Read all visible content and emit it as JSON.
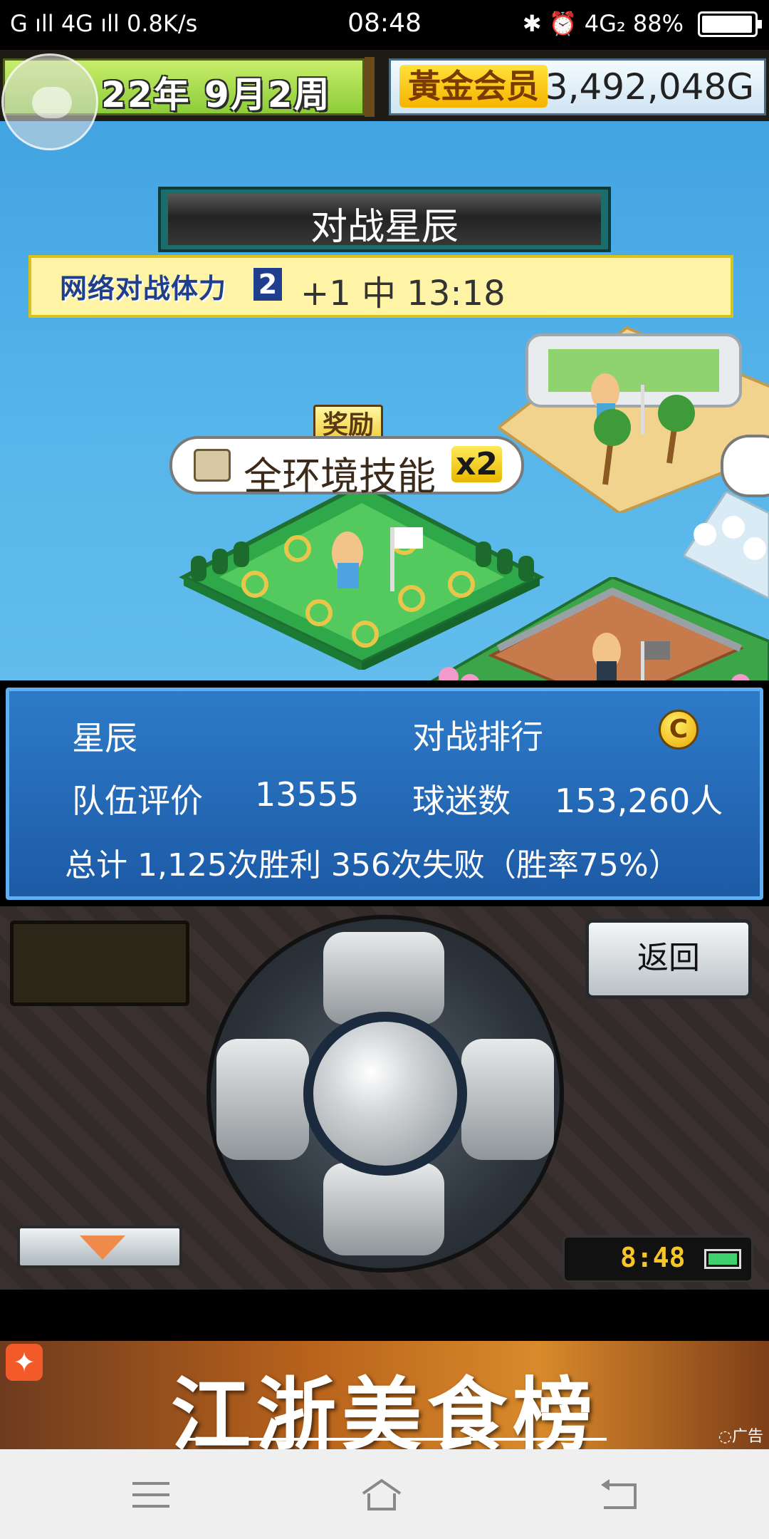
{
  "status_bar": {
    "left": "G  ıll  4G  ıll  0.8K/s",
    "time": "08:48",
    "right": "✱  ⏰  4G₂  88%",
    "battery_level": 0.88
  },
  "game": {
    "date": "22年 9月2周",
    "member_label": "黃金会员",
    "money": "3,492,048G",
    "match_title": "对战星辰",
    "battle_power_label": "网络对战体力",
    "battle_power_value": "2",
    "battle_power_status": "+1  中  13:18",
    "reward_label": "奖励",
    "skill_bubble": "全环境技能",
    "skill_multiplier": "x2"
  },
  "info": {
    "team_name": "星辰",
    "ranking_label": "对战排行",
    "ranking_grade": "C",
    "team_rating_label": "队伍评价",
    "team_rating_value": "13555",
    "fans_label": "球迷数",
    "fans_value": "153,260人",
    "record": "总计   1,125次胜利   356次失败（胜率75%）"
  },
  "controller": {
    "back_button": "返回",
    "clock": "8:48",
    "battery_level": 0.88
  },
  "ad": {
    "headline": "江浙美食榜",
    "tag": "◌广告",
    "icon": "person-icon"
  },
  "navbar": {
    "icons": [
      "menu-icon",
      "home-icon",
      "back-icon"
    ]
  }
}
